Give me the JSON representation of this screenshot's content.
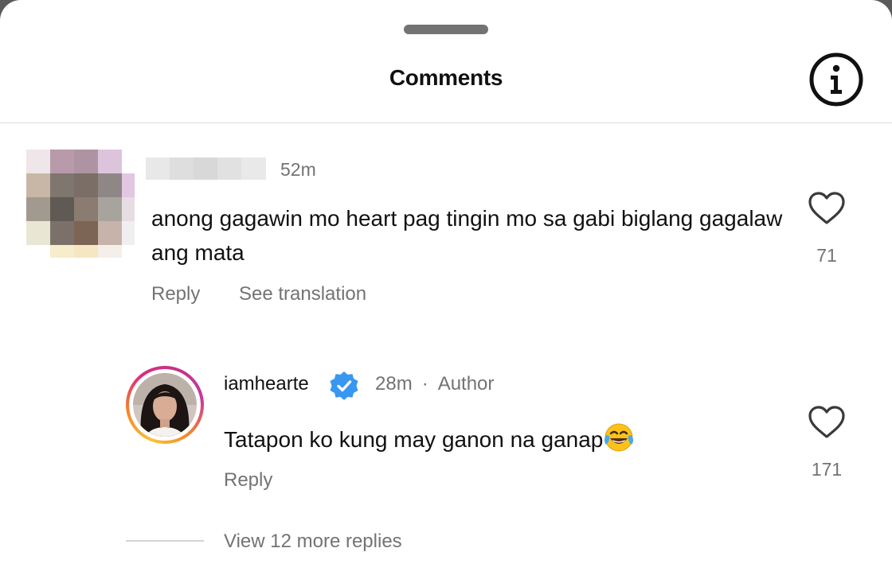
{
  "header": {
    "title": "Comments",
    "info_icon": "info-icon"
  },
  "comments": [
    {
      "username": "",
      "time": "52m",
      "text": "anong gagawin mo heart pag tingin mo sa gabi biglang gagalaw ang mata",
      "reply_label": "Reply",
      "translate_label": "See translation",
      "likes": "71",
      "like_icon": "heart-outline-icon"
    }
  ],
  "replies": [
    {
      "username": "iamhearte",
      "verified": true,
      "time": "28m",
      "separator": "·",
      "author_badge": "Author",
      "text": "Tatapon ko kung may ganon na ganap",
      "emoji": "face-with-tears-of-joy",
      "reply_label": "Reply",
      "likes": "171",
      "like_icon": "heart-outline-icon"
    }
  ],
  "view_more": "View 12 more replies",
  "colors": {
    "text_primary": "#111111",
    "text_secondary": "#737373",
    "divider": "#dcdcdc",
    "verified_blue": "#3897f0"
  }
}
